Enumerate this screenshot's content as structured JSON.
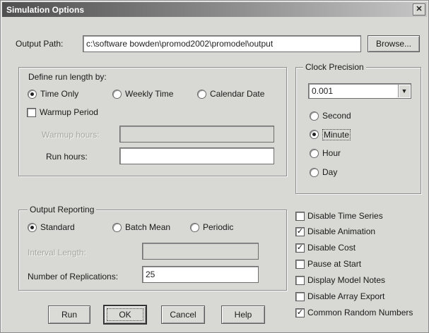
{
  "window": {
    "title": "Simulation Options",
    "close_glyph": "✕"
  },
  "output_path": {
    "label": "Output Path:",
    "value": "c:\\software bowden\\promod2002\\promodel\\output",
    "browse_label": "Browse..."
  },
  "run_length": {
    "legend": "Define run length by:",
    "options": [
      "Time Only",
      "Weekly Time",
      "Calendar Date"
    ],
    "selected": "Time Only",
    "warmup_period_label": "Warmup Period",
    "warmup_period_checked": false,
    "warmup_hours_label": "Warmup hours:",
    "warmup_hours_value": "",
    "run_hours_label": "Run hours:",
    "run_hours_value": ""
  },
  "clock_precision": {
    "legend": "Clock Precision",
    "value": "0.001",
    "dropdown_icon": "chevron-down-icon",
    "options": [
      "Second",
      "Minute",
      "Hour",
      "Day"
    ],
    "selected": "Minute"
  },
  "output_reporting": {
    "legend": "Output Reporting",
    "options": [
      "Standard",
      "Batch Mean",
      "Periodic"
    ],
    "selected": "Standard",
    "interval_length_label": "Interval Length:",
    "interval_length_value": "",
    "replications_label": "Number of Replications:",
    "replications_value": "25"
  },
  "checkboxes": [
    {
      "label": "Disable Time Series",
      "checked": false
    },
    {
      "label": "Disable Animation",
      "checked": true
    },
    {
      "label": "Disable Cost",
      "checked": true
    },
    {
      "label": "Pause at Start",
      "checked": false
    },
    {
      "label": "Display Model Notes",
      "checked": false
    },
    {
      "label": "Disable Array Export",
      "checked": false
    },
    {
      "label": "Common Random Numbers",
      "checked": true
    }
  ],
  "buttons": {
    "run": "Run",
    "ok": "OK",
    "cancel": "Cancel",
    "help": "Help"
  }
}
